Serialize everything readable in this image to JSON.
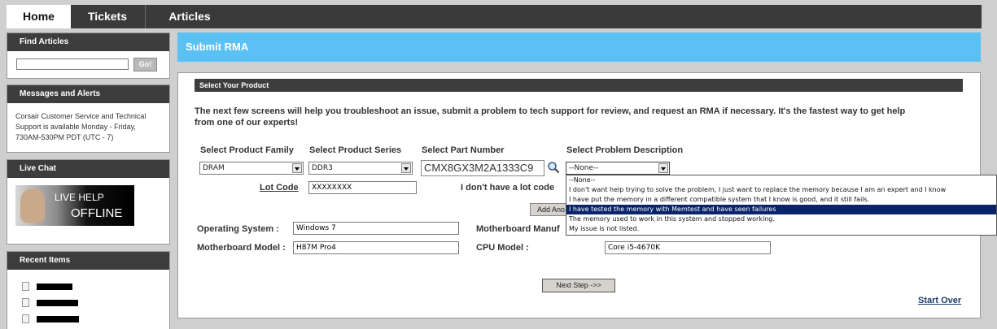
{
  "nav": {
    "tabs": [
      {
        "label": "Home"
      },
      {
        "label": "Tickets"
      },
      {
        "label": "Articles"
      }
    ]
  },
  "sidebar": {
    "find_articles": {
      "title": "Find Articles",
      "search_value": "",
      "go_label": "Go!"
    },
    "messages": {
      "title": "Messages and Alerts",
      "lines": [
        "Corsair Customer Service and Technical",
        "Support is available Monday - Friday,",
        "730AM-530PM PDT (UTC - 7)"
      ]
    },
    "live_chat": {
      "title": "Live Chat",
      "line1": "LIVE HELP",
      "line2": "OFFLINE"
    },
    "recent_items": {
      "title": "Recent Items"
    }
  },
  "main": {
    "header": "Submit RMA",
    "section_title": "Select Your Product",
    "intro_line1": "The next few screens will help you troubleshoot an issue, submit a problem to tech support for review, and request an RMA if necessary. It's the fastest way to get help",
    "intro_line2": "from one of our experts!",
    "product_family": {
      "label": "Select Product Family",
      "value": "DRAM"
    },
    "product_series": {
      "label": "Select Product Series",
      "value": "DDR3"
    },
    "part_number": {
      "label": "Select Part Number",
      "value": "CMX8GX3M2A1333C9"
    },
    "problem": {
      "label": "Select Problem Description",
      "value": "--None--",
      "options": [
        "--None--",
        "I don't want help trying to solve the problem, I just want to replace the memory because I am an expert and I know",
        "I have put the memory in a different compatible system that I know is good, and it still fails.",
        "I have tested the memory with Memtest and have seen failures",
        "The memory used to work in this system and stopped working.",
        "My issue is not listed."
      ],
      "highlighted_index": 3
    },
    "lot_code": {
      "label": "Lot Code",
      "value": "XXXXXXXX",
      "no_lot_text": "I don't have a lot code"
    },
    "add_button": "Add Ano",
    "os": {
      "label": "Operating System :",
      "value": "Windows 7"
    },
    "mb_manufacturer": {
      "label": "Motherboard Manuf"
    },
    "mb_model": {
      "label": "Motherboard Model :",
      "value": "H87M Pro4"
    },
    "cpu_model": {
      "label": "CPU Model :",
      "value": "Core i5-4670K"
    },
    "next_step": "Next Step ->>",
    "start_over": "Start Over"
  }
}
